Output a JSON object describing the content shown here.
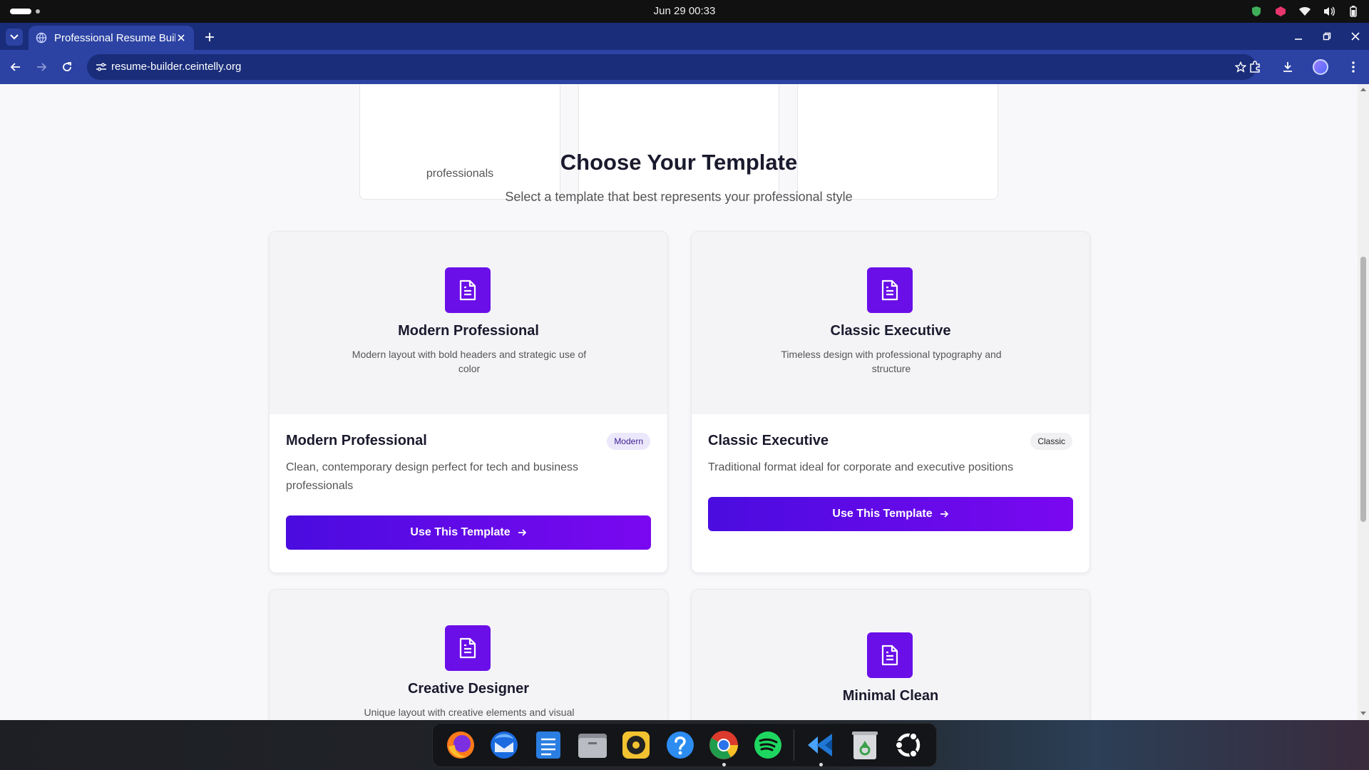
{
  "system": {
    "clock": "Jun 29  00:33"
  },
  "browser": {
    "tab_title": "Professional Resume Builder",
    "url": "resume-builder.ceintelly.org"
  },
  "page": {
    "feature_card_text": "professionals",
    "section_title": "Choose Your Template",
    "section_subtitle": "Select a template that best represents your professional style",
    "templates": [
      {
        "preview_title": "Modern Professional",
        "preview_desc": "Modern layout with bold headers and strategic use of color",
        "name": "Modern Professional",
        "badge": "Modern",
        "desc": "Clean, contemporary design perfect for tech and business professionals",
        "button": "Use This Template"
      },
      {
        "preview_title": "Classic Executive",
        "preview_desc": "Timeless design with professional typography and structure",
        "name": "Classic Executive",
        "badge": "Classic",
        "desc": "Traditional format ideal for corporate and executive positions",
        "button": "Use This Template"
      },
      {
        "preview_title": "Creative Designer",
        "preview_desc": "Unique layout with creative elements and visual"
      },
      {
        "preview_title": "Minimal Clean"
      }
    ]
  },
  "dock": {
    "apps": [
      "firefox-icon",
      "thunderbird-icon",
      "text-editor-icon",
      "files-icon",
      "rhythmbox-icon",
      "help-icon",
      "chrome-icon",
      "spotify-icon",
      "vscode-icon",
      "trash-icon",
      "ubuntu-icon"
    ]
  },
  "colors": {
    "accent": "#6a0fe8",
    "browser_frame": "#2c43a3",
    "tabstrip": "#1a2d7a"
  }
}
